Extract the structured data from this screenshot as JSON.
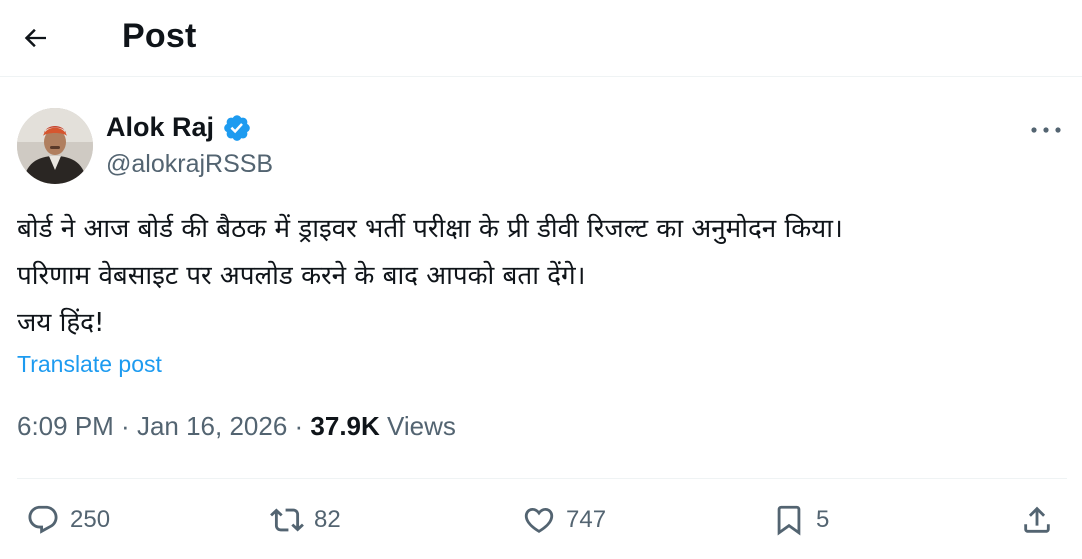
{
  "header": {
    "title": "Post"
  },
  "author": {
    "name": "Alok Raj",
    "handle": "@alokrajRSSB",
    "verified": true,
    "verified_color": "#1d9bf0"
  },
  "post": {
    "lines": [
      "बोर्ड ने आज बोर्ड की बैठक में ड्राइवर भर्ती परीक्षा के प्री डीवी रिजल्ट का अनुमोदन किया।",
      "परिणाम वेबसाइट पर अपलोड करने के  बाद आपको बता देंगे।",
      "जय हिंद!"
    ],
    "translate_label": "Translate post"
  },
  "meta": {
    "time": "6:09 PM",
    "separator": " · ",
    "date": "Jan 16, 2026",
    "views_count": "37.9K",
    "views_label": "Views"
  },
  "actions": {
    "replies": "250",
    "reposts": "82",
    "likes": "747",
    "bookmarks": "5"
  },
  "icons": {
    "back": "arrow-left-icon",
    "verified": "verified-badge-icon",
    "more": "more-horizontal-icon",
    "reply": "reply-bubble-icon",
    "repost": "repost-icon",
    "like": "heart-icon",
    "bookmark": "bookmark-icon",
    "share": "share-upload-icon"
  },
  "colors": {
    "text_primary": "#0f1419",
    "text_secondary": "#536471",
    "link": "#1d9bf0",
    "divider": "#eff3f4"
  }
}
